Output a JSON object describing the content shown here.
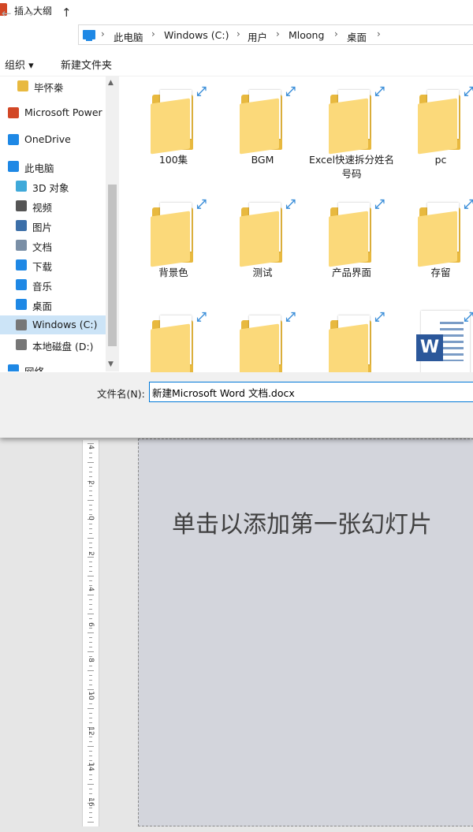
{
  "window": {
    "title": "插入大纲"
  },
  "address": {
    "crumbs": [
      "此电脑",
      "Windows (C:)",
      "用户",
      "Mloong",
      "桌面"
    ]
  },
  "toolbar": {
    "organize_label": "组织 ▾",
    "new_folder_label": "新建文件夹"
  },
  "nav": {
    "items": [
      {
        "label": "毕怀桊",
        "icon": "folder-icon"
      },
      {
        "label": "Microsoft Power",
        "icon": "powerpoint-icon"
      },
      {
        "label": "OneDrive",
        "icon": "onedrive-icon"
      },
      {
        "label": "此电脑",
        "icon": "pc-icon"
      },
      {
        "label": "3D 对象",
        "icon": "3d-objects-icon"
      },
      {
        "label": "视频",
        "icon": "videos-icon"
      },
      {
        "label": "图片",
        "icon": "pictures-icon"
      },
      {
        "label": "文档",
        "icon": "documents-icon"
      },
      {
        "label": "下载",
        "icon": "downloads-icon"
      },
      {
        "label": "音乐",
        "icon": "music-icon"
      },
      {
        "label": "桌面",
        "icon": "desktop-icon"
      },
      {
        "label": "Windows (C:)",
        "icon": "drive-icon",
        "selected": true
      },
      {
        "label": "本地磁盘 (D:)",
        "icon": "drive-icon"
      },
      {
        "label": "网络",
        "icon": "network-icon"
      }
    ]
  },
  "files": [
    {
      "name": "100集",
      "type": "folder"
    },
    {
      "name": "BGM",
      "type": "folder"
    },
    {
      "name": "Excel快速拆分姓名号码",
      "type": "folder"
    },
    {
      "name": "pc",
      "type": "folder"
    },
    {
      "name": "背景色",
      "type": "folder"
    },
    {
      "name": "测试",
      "type": "folder"
    },
    {
      "name": "产品界面",
      "type": "folder"
    },
    {
      "name": "存留",
      "type": "folder"
    },
    {
      "name": "",
      "type": "folder"
    },
    {
      "name": "",
      "type": "folder"
    },
    {
      "name": "",
      "type": "folder"
    },
    {
      "name": "",
      "type": "word"
    }
  ],
  "filename": {
    "label": "文件名(N):",
    "value": "新建Microsoft Word 文档.docx"
  },
  "slide": {
    "placeholder": "单击以添加第一张幻灯片"
  },
  "ruler": {
    "labels": [
      "4",
      "2",
      "0",
      "2",
      "4",
      "6",
      "8",
      "10",
      "12",
      "14",
      "16"
    ]
  },
  "colors": {
    "accent": "#0078d7",
    "folder": "#fbd97a",
    "slide_bg": "#d3d5dc",
    "word": "#2b579a"
  }
}
